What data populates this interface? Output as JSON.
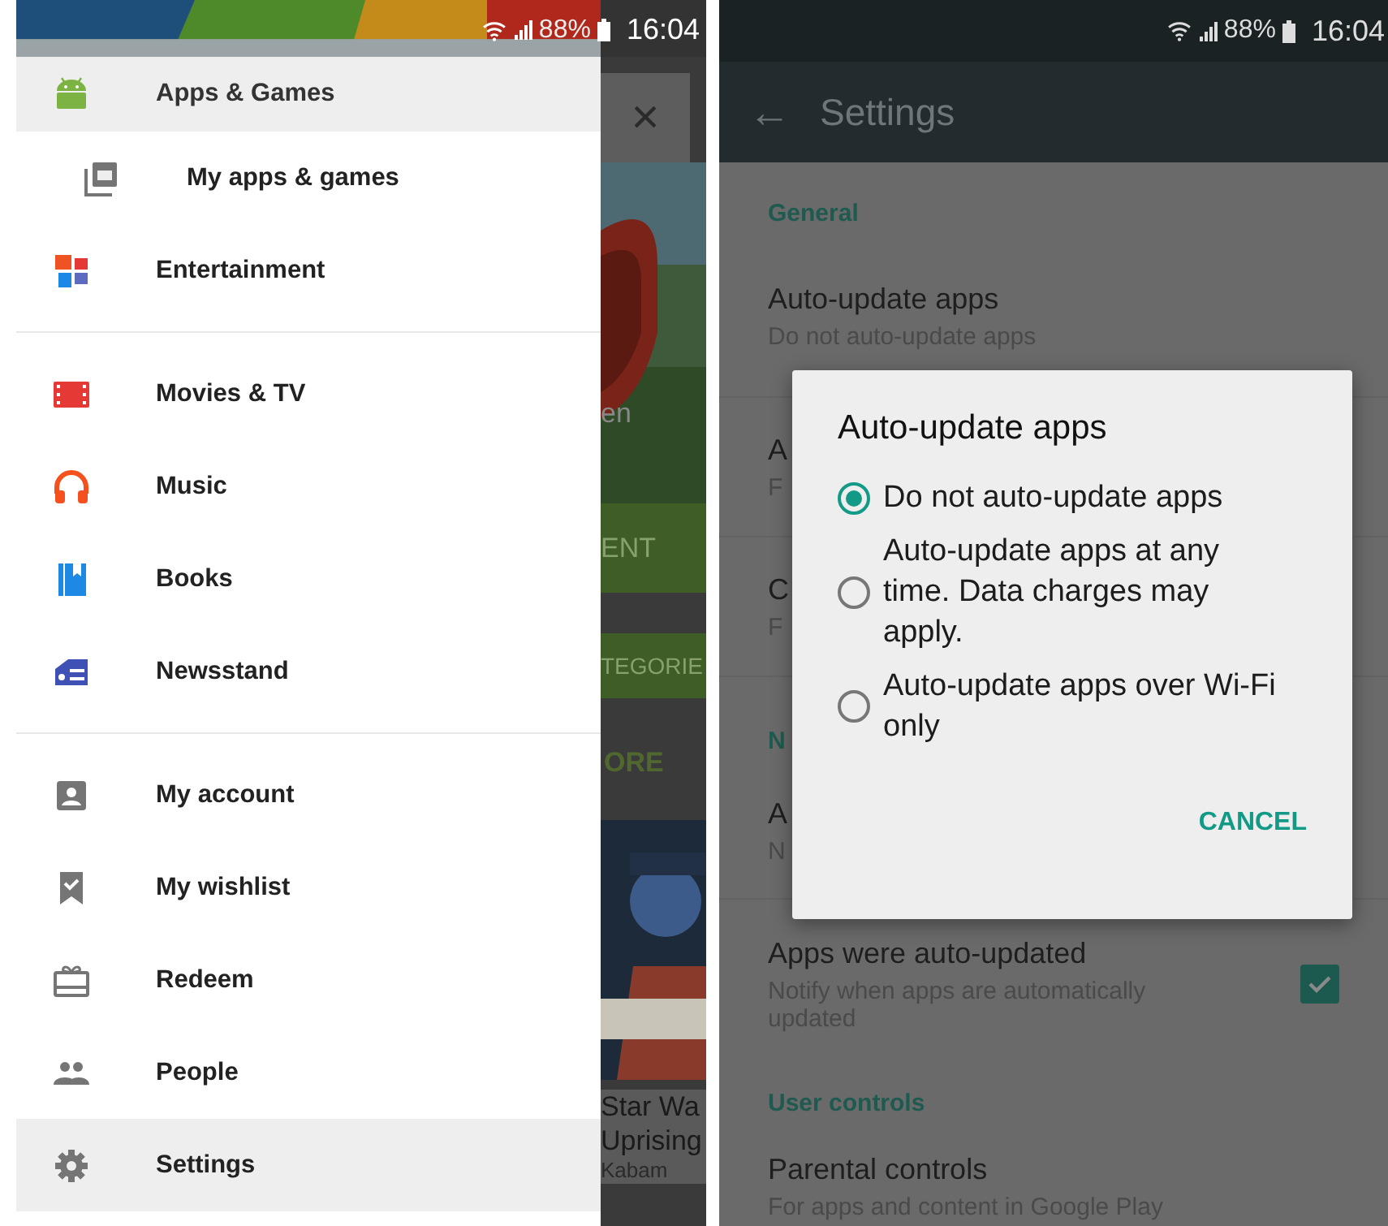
{
  "left_phone": {
    "status_bar": {
      "battery": "88%",
      "time": "16:04"
    },
    "drawer": {
      "groups": [
        [
          {
            "label": "Apps & Games",
            "selected": true,
            "children": [
              {
                "label": "My apps & games",
                "selected": false
              }
            ]
          },
          {
            "label": "Entertainment",
            "selected": false
          }
        ],
        [
          {
            "label": "Movies & TV",
            "selected": false
          },
          {
            "label": "Music",
            "selected": false
          },
          {
            "label": "Books",
            "selected": false
          },
          {
            "label": "Newsstand",
            "selected": false
          }
        ],
        [
          {
            "label": "My account",
            "selected": false
          },
          {
            "label": "My wishlist",
            "selected": false
          },
          {
            "label": "Redeem",
            "selected": false
          },
          {
            "label": "People",
            "selected": false
          },
          {
            "label": "Settings",
            "selected": true
          }
        ]
      ]
    },
    "background_app": {
      "close": "×",
      "texts": [
        "en",
        "ENT",
        "TEGORIE",
        "ORE"
      ],
      "card_title": [
        "Star Wa",
        "Uprising"
      ],
      "card_publisher": "Kabam"
    }
  },
  "right_phone": {
    "status_bar": {
      "battery": "88%",
      "time": "16:04"
    },
    "toolbar": {
      "back": "←",
      "title": "Settings"
    },
    "sections": [
      {
        "header": "General",
        "rows": [
          {
            "title": "Auto-update apps",
            "subtitle": "Do not auto-update apps"
          },
          {
            "title": "A",
            "subtitle": "F"
          },
          {
            "title": "C",
            "subtitle": "F"
          }
        ]
      },
      {
        "header": "N",
        "rows": [
          {
            "title": "A",
            "subtitle": "N"
          },
          {
            "title": "Apps were auto-updated",
            "subtitle": "Notify when apps are automatically updated",
            "checked": true
          }
        ]
      },
      {
        "header": "User controls",
        "rows": [
          {
            "title": "Parental controls",
            "subtitle": "For apps and content in Google Play"
          }
        ]
      }
    ],
    "dialog": {
      "title": "Auto-update apps",
      "options": [
        {
          "label": "Do not auto-update apps",
          "selected": true
        },
        {
          "label": "Auto-update apps at any time. Data charges may apply.",
          "selected": false
        },
        {
          "label": "Auto-update apps over Wi-Fi only",
          "selected": false
        }
      ],
      "button": "CANCEL"
    }
  }
}
